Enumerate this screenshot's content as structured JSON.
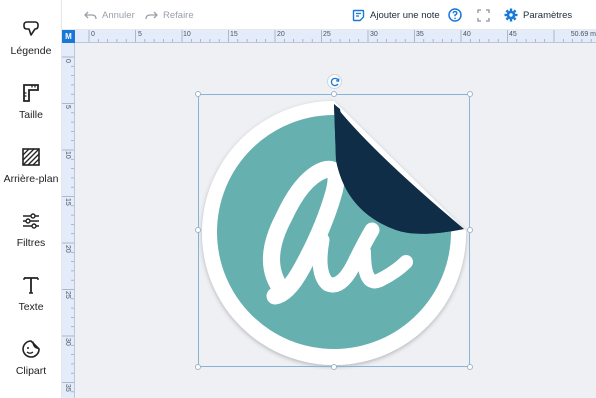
{
  "sidebar": {
    "items": [
      {
        "label": "Légende",
        "icon": "speech-bubble-icon"
      },
      {
        "label": "Taille",
        "icon": "ruler-corner-icon"
      },
      {
        "label": "Arrière-plan",
        "icon": "hatched-square-icon"
      },
      {
        "label": "Filtres",
        "icon": "sliders-icon"
      },
      {
        "label": "Texte",
        "icon": "text-t-icon"
      },
      {
        "label": "Clipart",
        "icon": "sticker-face-icon"
      }
    ]
  },
  "toolbar": {
    "undo_label": "Annuler",
    "redo_label": "Refaire",
    "add_note_label": "Ajouter une note",
    "settings_label": "Paramètres"
  },
  "ruler": {
    "corner_unit": "M",
    "h_ticks": [
      "0",
      "5",
      "10",
      "15",
      "20",
      "25",
      "30",
      "35",
      "40",
      "45"
    ],
    "v_ticks": [
      "0",
      "5",
      "10",
      "15",
      "20",
      "25",
      "30",
      "35"
    ],
    "width_readout": "50.69 m"
  },
  "colors": {
    "accent": "#1a78d8",
    "sticker_teal": "#66b0b0",
    "sticker_peel": "#0f2d47"
  }
}
